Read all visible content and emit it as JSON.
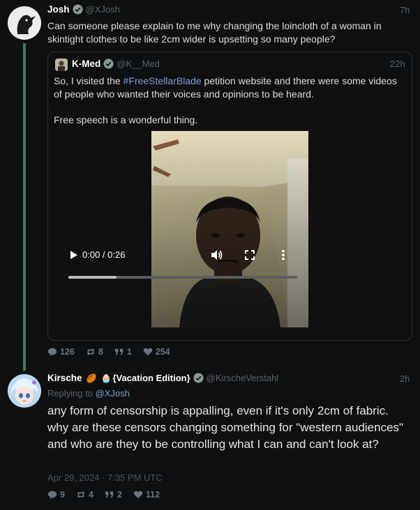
{
  "main_tweet": {
    "name": "Josh",
    "handle": "@XJosh",
    "time": "7h",
    "text": "Can someone please explain to me why changing the loincloth of a woman in skintight clothes to be like 2cm wider is upsetting so many people?",
    "stats": {
      "replies": "126",
      "retweets": "8",
      "quotes": "1",
      "likes": "254"
    }
  },
  "quoted_tweet": {
    "name": "K-Med",
    "handle": "@K__Med",
    "time": "22h",
    "text_before": "So, I visited the ",
    "hashtag": "#FreeStellarBlade",
    "text_after": " petition website and there were some videos of people who wanted their voices and opinions to be heard.",
    "text2": "Free speech is a wonderful thing.",
    "video": {
      "time_display": "0:00 / 0:26",
      "progress": 0.21
    }
  },
  "reply": {
    "name": "Kirsche",
    "name_suffix": "{Vacation Edition}",
    "handle": "@KirscheVerstahl",
    "time": "2h",
    "replying_label": "Replying to",
    "replying_to": "@XJosh",
    "text": "any form of censorship is appalling, even if it's only 2cm of fabric. why are these censors changing something for \"western audiences\" and who are they to be controlling what I can and can't look at?",
    "date": "Apr 29, 2024 · 7:35 PM UTC",
    "stats": {
      "replies": "9",
      "retweets": "4",
      "quotes": "2",
      "likes": "112"
    }
  },
  "colors": {
    "accent": "#7e9ed8",
    "verified": "#8a9a93",
    "thread": "#3b7d5e"
  }
}
